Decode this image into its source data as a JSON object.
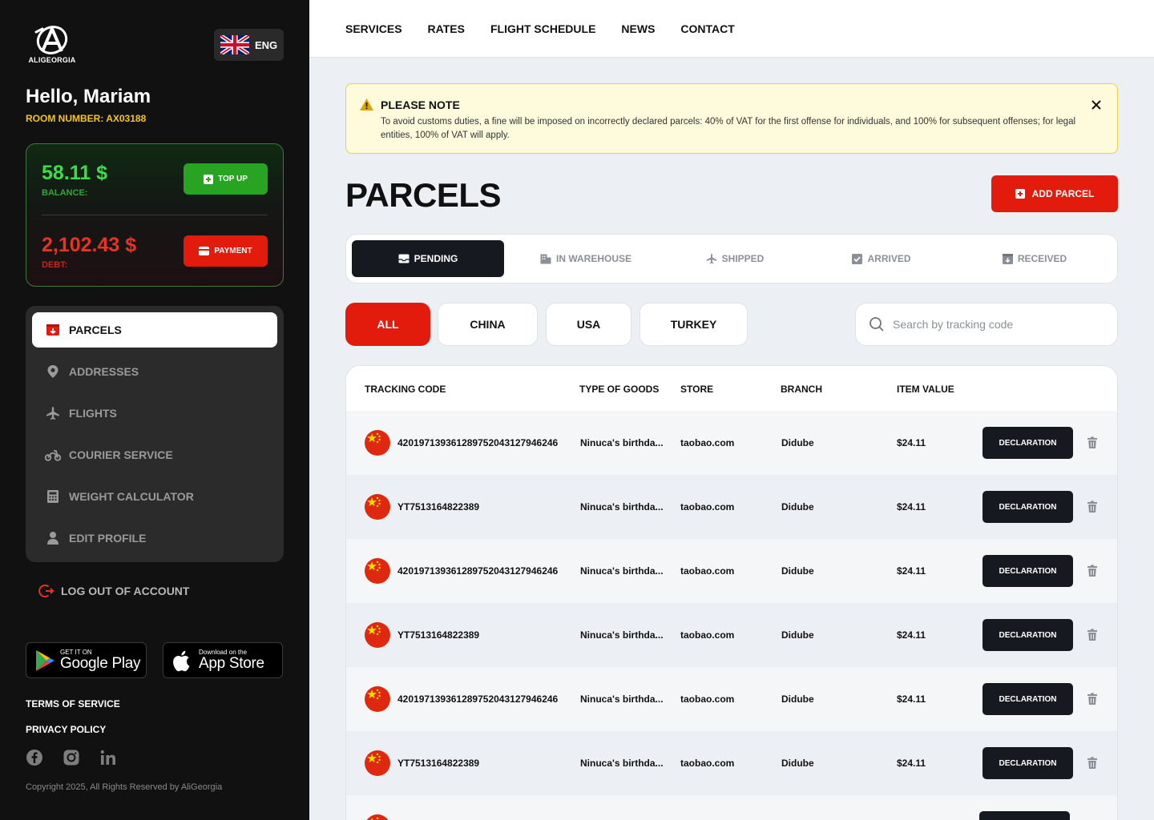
{
  "brand": {
    "name": "ALIGEORGIA"
  },
  "language": {
    "label": "ENG",
    "flag_icon": "uk-flag-icon"
  },
  "user": {
    "greeting": "Hello, Mariam",
    "room": "ROOM NUMBER: AX03188"
  },
  "wallet": {
    "balance_value": "58.11 $",
    "balance_label": "BALANCE:",
    "topup_label": "TOP UP",
    "debt_value": "2,102.43 $",
    "debt_label": "DEBT:",
    "payment_label": "PAYMENT"
  },
  "sidebar_nav": [
    {
      "label": "PARCELS",
      "icon": "parcel-icon",
      "active": true
    },
    {
      "label": "ADDRESSES",
      "icon": "location-pin-icon",
      "active": false
    },
    {
      "label": "FLIGHTS",
      "icon": "airplane-icon",
      "active": false
    },
    {
      "label": "COURIER SERVICE",
      "icon": "motorbike-icon",
      "active": false
    },
    {
      "label": "WEIGHT CALCULATOR",
      "icon": "calculator-icon",
      "active": false
    },
    {
      "label": "EDIT PROFILE",
      "icon": "user-icon",
      "active": false
    }
  ],
  "logout_label": "LOG OUT OF ACCOUNT",
  "stores": {
    "google_small": "GET IT ON",
    "google_big": "Google Play",
    "apple_small": "Download on the",
    "apple_big": "App Store"
  },
  "footer_links": {
    "terms": "TERMS OF SERVICE",
    "privacy": "PRIVACY POLICY"
  },
  "socials": [
    "facebook-icon",
    "instagram-icon",
    "linkedin-icon"
  ],
  "copyright": "Copyright 2025, All Rights Reserved by AliGeorgia",
  "top_nav": [
    "SERVICES",
    "RATES",
    "FLIGHT SCHEDULE",
    "NEWS",
    "CONTACT"
  ],
  "notice": {
    "title": "PLEASE NOTE",
    "text": "To avoid customs duties, a fine will be imposed on incorrectly declared parcels: 40% of VAT for the first offense for individuals, and 100% for subsequent offenses; for legal entities, 100% of VAT will apply."
  },
  "page_title": "PARCELS",
  "add_parcel_label": "ADD PARCEL",
  "status_tabs": [
    {
      "label": "PENDING",
      "icon": "inbox-icon",
      "active": true
    },
    {
      "label": "IN WAREHOUSE",
      "icon": "warehouse-icon",
      "active": false
    },
    {
      "label": "SHIPPED",
      "icon": "airplane-icon",
      "active": false
    },
    {
      "label": "ARRIVED",
      "icon": "checkbox-icon",
      "active": false
    },
    {
      "label": "RECEIVED",
      "icon": "box-received-icon",
      "active": false
    }
  ],
  "country_filters": [
    {
      "label": "ALL",
      "active": true
    },
    {
      "label": "CHINA",
      "active": false
    },
    {
      "label": "USA",
      "active": false
    },
    {
      "label": "TURKEY",
      "active": false
    }
  ],
  "search": {
    "placeholder": "Search by tracking code",
    "value": ""
  },
  "table": {
    "headers": [
      "TRACKING CODE",
      "TYPE OF GOODS",
      "STORE",
      "BRANCH",
      "ITEM VALUE"
    ],
    "declaration_label": "DECLARATION",
    "rows": [
      {
        "flag": "china-flag-icon",
        "tracking": "4201971393612897520431279462​46",
        "goods": "Ninuca's birthda...",
        "store": "taobao.com",
        "branch": "Didube",
        "value": "$24.11"
      },
      {
        "flag": "china-flag-icon",
        "tracking": "YT7513164822389",
        "goods": "Ninuca's birthda...",
        "store": "taobao.com",
        "branch": "Didube",
        "value": "$24.11"
      },
      {
        "flag": "china-flag-icon",
        "tracking": "420197139361289752043127946246",
        "goods": "Ninuca's birthda...",
        "store": "taobao.com",
        "branch": "Didube",
        "value": "$24.11"
      },
      {
        "flag": "china-flag-icon",
        "tracking": "YT7513164822389",
        "goods": "Ninuca's birthda...",
        "store": "taobao.com",
        "branch": "Didube",
        "value": "$24.11"
      },
      {
        "flag": "china-flag-icon",
        "tracking": "420197139361289752043127946246",
        "goods": "Ninuca's birthda...",
        "store": "taobao.com",
        "branch": "Didube",
        "value": "$24.11"
      },
      {
        "flag": "china-flag-icon",
        "tracking": "YT7513164822389",
        "goods": "Ninuca's birthda...",
        "store": "taobao.com",
        "branch": "Didube",
        "value": "$24.11"
      },
      {
        "flag": "china-flag-icon",
        "tracking": "",
        "goods": "",
        "store": "",
        "branch": "",
        "value": ""
      }
    ]
  },
  "colors": {
    "accent_red": "#e31b0c",
    "accent_green": "#28a322",
    "balance_green": "#3ddc4b",
    "debt_red": "#e53325",
    "room_yellow": "#f5c518",
    "dark": "#161a20",
    "sidebar_bg": "#111111",
    "notice_bg": "#fdfbdc"
  }
}
